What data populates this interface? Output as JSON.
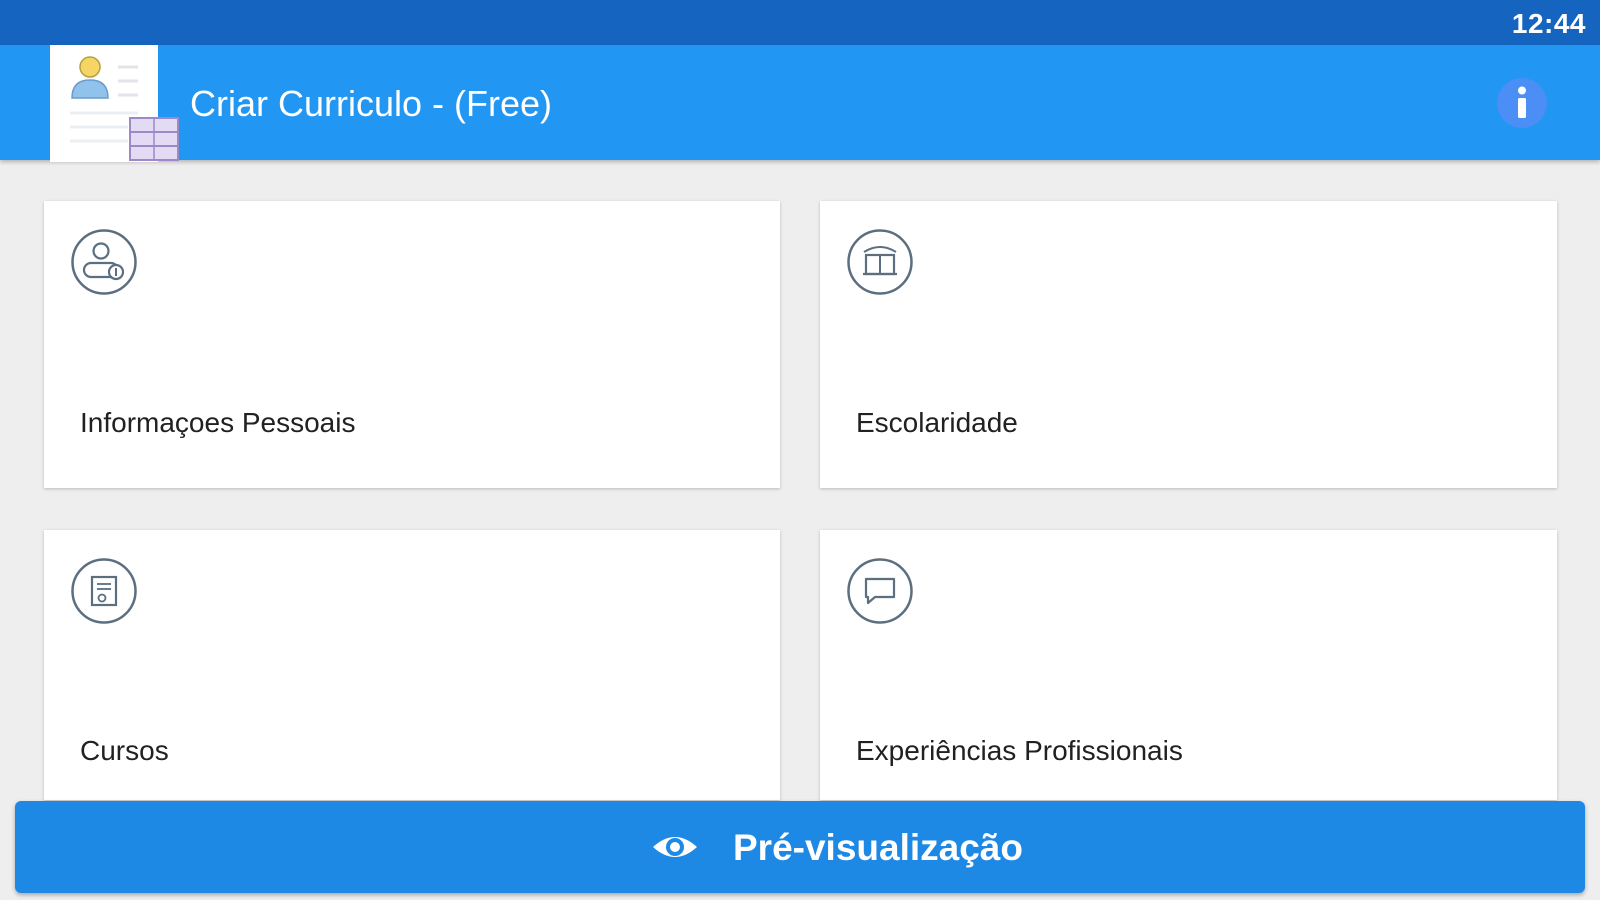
{
  "status_bar": {
    "time": "12:44"
  },
  "app_bar": {
    "title": "Criar Curriculo - (Free)",
    "logo_icon": "resume-document-icon",
    "info_icon": "info-icon"
  },
  "menu": {
    "cards": [
      {
        "label": "Informaçoes Pessoais",
        "icon": "person-id-icon"
      },
      {
        "label": "Escolaridade",
        "icon": "book-icon"
      },
      {
        "label": "Cursos",
        "icon": "certificate-icon"
      },
      {
        "label": "Experiências Profissionais",
        "icon": "chat-bubble-icon"
      }
    ]
  },
  "preview_button": {
    "label": "Pré-visualização",
    "icon": "eye-icon"
  },
  "colors": {
    "status_bar": "#1565c0",
    "app_bar": "#2196f3",
    "background": "#eeeeee",
    "icon_stroke": "#5b6f80",
    "button": "#1e88e5"
  }
}
